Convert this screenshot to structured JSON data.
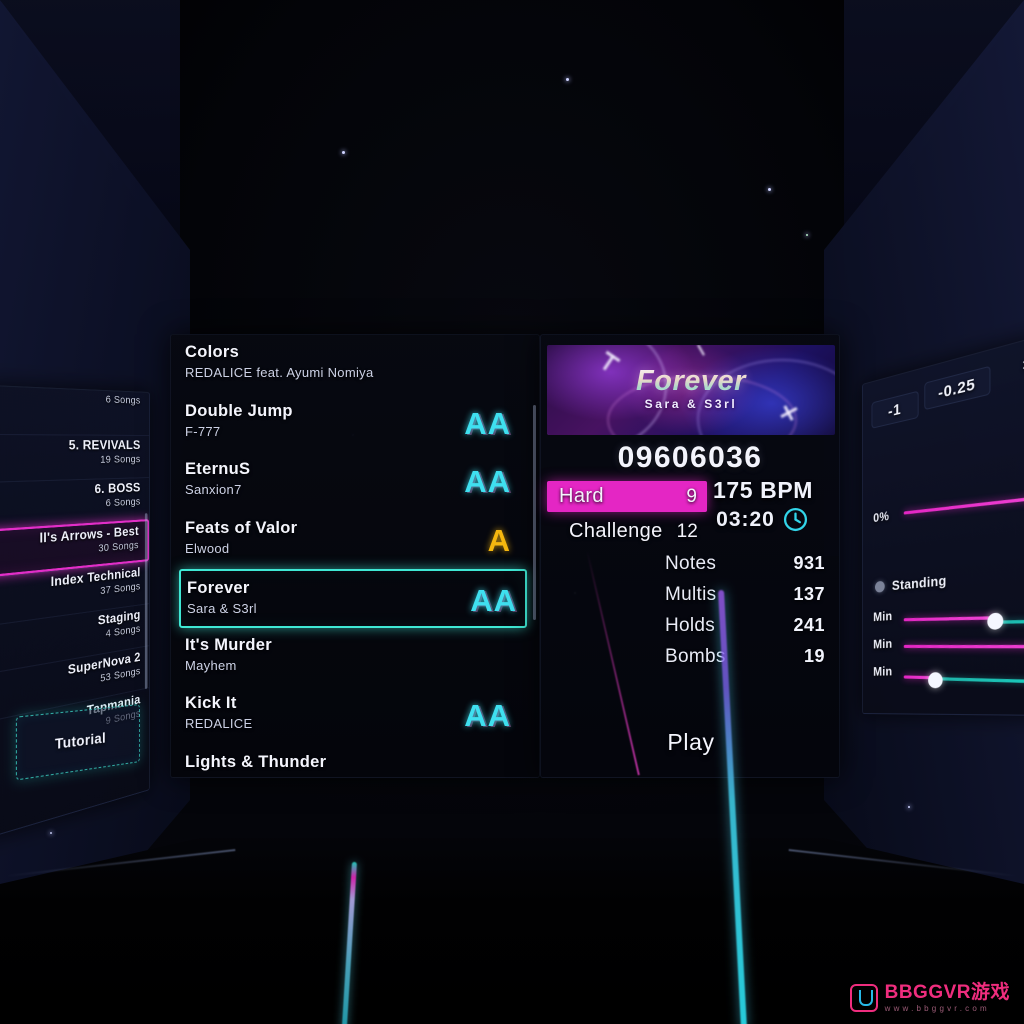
{
  "packs": {
    "scroll_visible": true,
    "items": [
      {
        "name": "",
        "count": "6 Songs",
        "selected": false
      },
      {
        "name": "5. REVIVALS",
        "count": "19 Songs",
        "selected": false
      },
      {
        "name": "6. BOSS",
        "count": "6 Songs",
        "selected": false
      },
      {
        "name": "ll's Arrows - Best",
        "count": "30 Songs",
        "selected": true
      },
      {
        "name": "Index Technical",
        "count": "37 Songs",
        "selected": false
      },
      {
        "name": "Staging",
        "count": "4 Songs",
        "selected": false
      },
      {
        "name": "SuperNova 2",
        "count": "53 Songs",
        "selected": false
      },
      {
        "name": "Tapmania",
        "count": "9 Songs",
        "selected": false
      }
    ],
    "tutorial_label": "Tutorial"
  },
  "songs": [
    {
      "title": "Colors",
      "artist": "REDALICE feat. Ayumi Nomiya",
      "grade": "",
      "selected": false
    },
    {
      "title": "Double Jump",
      "artist": "F-777",
      "grade": "AA",
      "selected": false
    },
    {
      "title": "EternuS",
      "artist": "Sanxion7",
      "grade": "AA",
      "selected": false
    },
    {
      "title": "Feats of Valor",
      "artist": "Elwood",
      "grade": "A",
      "selected": false
    },
    {
      "title": "Forever",
      "artist": "Sara & S3rl",
      "grade": "AA",
      "selected": true
    },
    {
      "title": "It's Murder",
      "artist": "Mayhem",
      "grade": "",
      "selected": false
    },
    {
      "title": "Kick It",
      "artist": "REDALICE",
      "grade": "AA",
      "selected": false
    },
    {
      "title": "Lights & Thunder",
      "artist": "",
      "grade": "",
      "selected": false
    }
  ],
  "detail": {
    "art_title": "Forever",
    "art_artist": "Sara & S3rl",
    "score": "09606036",
    "difficulties": [
      {
        "name": "Hard",
        "level": "9",
        "active": true
      },
      {
        "name": "Challenge",
        "level": "12",
        "active": false
      }
    ],
    "bpm": "175 BPM",
    "duration": "03:20",
    "clock_icon": "clock-icon",
    "stats": [
      {
        "label": "Notes",
        "value": "931"
      },
      {
        "label": "Multis",
        "value": "137"
      },
      {
        "label": "Holds",
        "value": "241"
      },
      {
        "label": "Bombs",
        "value": "19"
      }
    ],
    "play_label": "Play"
  },
  "options": {
    "chips": [
      {
        "label": "-1"
      },
      {
        "label": "-0.25"
      }
    ],
    "percent_label": "0%",
    "mode_label": "Standing",
    "min_labels": [
      "Min",
      "Min",
      "Min"
    ]
  },
  "watermark": {
    "main": "BBGGVR游戏",
    "sub": "www.bbggvr.com"
  },
  "colors": {
    "accent_magenta": "#e426c4",
    "accent_teal": "#3fe8d4",
    "grade_aa": "#3fe0f0",
    "grade_a": "#f5b70f",
    "watermark_pink": "#ef2d7e"
  }
}
